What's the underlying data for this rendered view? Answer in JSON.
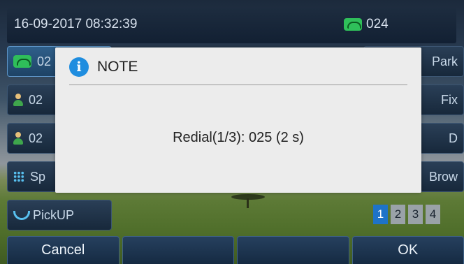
{
  "statusbar": {
    "datetime": "16-09-2017 08:32:39",
    "line_label": "024"
  },
  "line_keys_left": [
    {
      "label": "02",
      "icon": "phone-icon"
    },
    {
      "label": "02",
      "icon": "user-icon"
    },
    {
      "label": "02",
      "icon": "user-icon"
    },
    {
      "label": "Sp",
      "icon": "keypad-icon"
    },
    {
      "label": "PickUP",
      "icon": "pickup-icon"
    }
  ],
  "line_keys_right": [
    {
      "label": "Park"
    },
    {
      "label": "Fix"
    },
    {
      "label": "D"
    },
    {
      "label": "Brow"
    }
  ],
  "pages": [
    "1",
    "2",
    "3",
    "4"
  ],
  "current_page": "1",
  "softkeys": [
    "Cancel",
    "",
    "",
    "OK"
  ],
  "dialog": {
    "title": "NOTE",
    "icon": "info-icon",
    "message": "Redial(1/3): 025 (2 s)"
  },
  "colors": {
    "accent": "#1e73c8",
    "info": "#1f8ddf",
    "line_active": "#2fbf5a"
  }
}
